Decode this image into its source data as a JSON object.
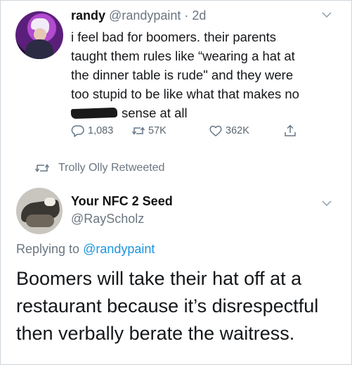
{
  "tweet1": {
    "name": "randy",
    "handle": "@randypaint",
    "dot": "·",
    "time": "2d",
    "text_lines": [
      "i feel bad for boomers. their parents",
      "taught them rules like “wearing a hat at",
      "the dinner table is rude\" and they were",
      "too stupid to be like what that makes no"
    ],
    "text_last_line": "sense at all",
    "stats": {
      "replies": "1,083",
      "retweets": "57K",
      "likes": "362K"
    }
  },
  "retweet_notice": {
    "label": "Trolly Olly Retweeted"
  },
  "tweet2": {
    "name": "Your NFC 2 Seed",
    "handle": "@RayScholz",
    "replying_prefix": "Replying to",
    "replying_to": "@randypaint",
    "text_lines": [
      "Boomers will take their hat off at a",
      "restaurant because it’s disrespectful",
      "then verbally berate the waitress."
    ]
  },
  "colors": {
    "secondary_text": "#6b7681",
    "link": "#1b95e0",
    "border": "#cfd6dc"
  },
  "icons": [
    "chevron-down-icon",
    "reply-icon",
    "retweet-icon",
    "like-icon",
    "share-icon"
  ]
}
